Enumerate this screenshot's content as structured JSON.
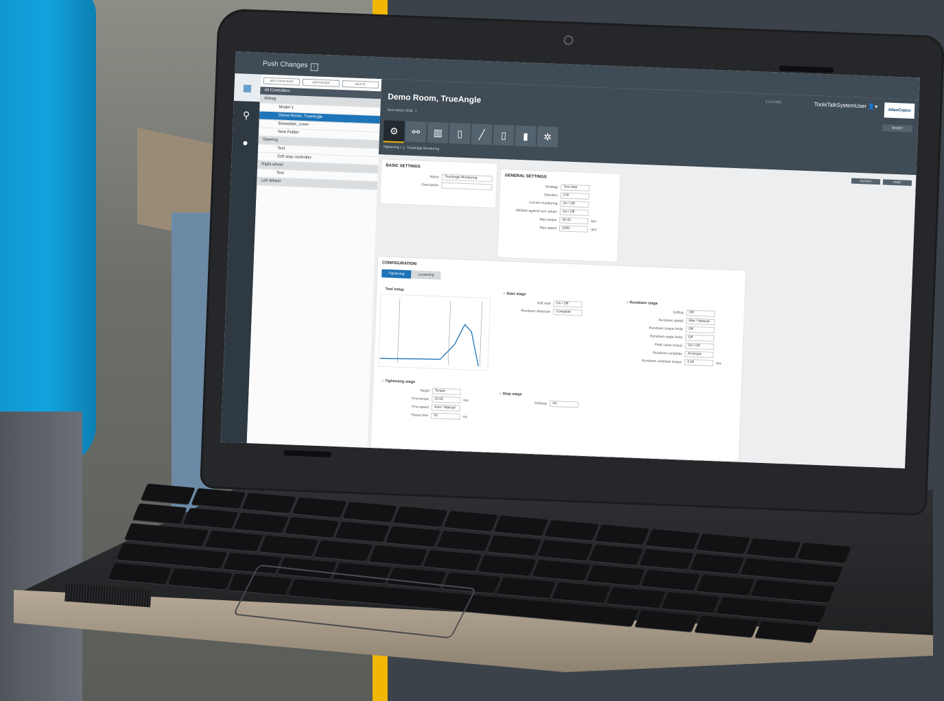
{
  "app": {
    "push_changes": "Push Changes",
    "rail": [
      "structure-icon",
      "search-icon",
      "controllers-icon"
    ],
    "tree_buttons": [
      "ADD STRUCTURE",
      "ADD FOLDER",
      "DELETE"
    ],
    "tree": [
      {
        "label": "All Controllers",
        "kind": "dark"
      },
      {
        "label": "Airbag",
        "kind": "group"
      },
      {
        "label": "Model 1",
        "kind": "item"
      },
      {
        "label": "Demo Room, TrueAngle",
        "kind": "sel"
      },
      {
        "label": "Baseplate_cover",
        "kind": "item"
      },
      {
        "label": "New Folder",
        "kind": "item"
      },
      {
        "label": "Steering",
        "kind": "group"
      },
      {
        "label": "Test",
        "kind": "item"
      },
      {
        "label": "Soft stop controller",
        "kind": "item"
      },
      {
        "label": "Right wheel",
        "kind": "group"
      },
      {
        "label": "Test",
        "kind": "item"
      },
      {
        "label": "Left Wheel",
        "kind": "group"
      }
    ],
    "user": "ToolsTalkSystemUser",
    "version": "2.3.0.7091",
    "logo": "AtlasCopco",
    "title": "Demo Room, TrueAngle",
    "description": "Description (Edit...)",
    "revert": "REVERT",
    "breadcrumb": "Tightening > 1. TrueAngle Monitoring",
    "history": "HISTORY",
    "print": "PRINT",
    "basic_settings": {
      "heading": "BASIC SETTINGS",
      "name_label": "Name",
      "name_value": "TrueAngle Monitoring",
      "description_label": "Description"
    },
    "general_settings": {
      "heading": "GENERAL SETTINGS",
      "fields": [
        {
          "label": "Strategy",
          "value": "Two step"
        },
        {
          "label": "Direction",
          "value": "CW"
        },
        {
          "label": "Current monitoring",
          "value": "On / Off"
        },
        {
          "label": "Validate against tool values",
          "value": "On / Off"
        },
        {
          "label": "Max torque",
          "value": "50.00",
          "unit": "Nm"
        },
        {
          "label": "Max speed",
          "value": "2300",
          "unit": "rpm"
        }
      ]
    },
    "configuration": {
      "heading": "CONFIGURATION",
      "tabs": [
        "Tightening",
        "Loosening"
      ],
      "tool_setup": "Tool setup",
      "start_stage": "Start stage",
      "soft_start": "Soft start",
      "soft_start_value": "On / Off",
      "rundown_detection": "Rundown detection",
      "rundown_detection_value": "Complete",
      "rundown_stage": "Rundown stage",
      "rundown_fields": [
        {
          "label": "Softtop",
          "value": "Off"
        },
        {
          "label": "Rundown speed",
          "value": "Max / Manual"
        },
        {
          "label": "Rundown torque limits",
          "value": "Off"
        },
        {
          "label": "Rundown angle limits",
          "value": "Off"
        },
        {
          "label": "Peak value torque",
          "value": "On / Off"
        },
        {
          "label": "Rundown complete",
          "value": "At torque"
        },
        {
          "label": "Rundown complete torque",
          "value": "4.00",
          "unit": "Nm"
        }
      ],
      "tightening_stage": "Tightening stage",
      "tightening_fields": [
        {
          "label": "Target",
          "value": "Torque"
        },
        {
          "label": "First torque",
          "value": "10.00",
          "unit": "Nm"
        },
        {
          "label": "First speed",
          "value": "Auto / Manual"
        },
        {
          "label": "Pause time",
          "value": "50",
          "unit": "ms"
        }
      ],
      "stop_stage": "Stop stage",
      "softstop": "Softstop",
      "softstop_value": "On"
    }
  },
  "colors": {
    "accent": "#f2b705",
    "brand_blue": "#1d74b8",
    "header": "#3f4b55"
  }
}
